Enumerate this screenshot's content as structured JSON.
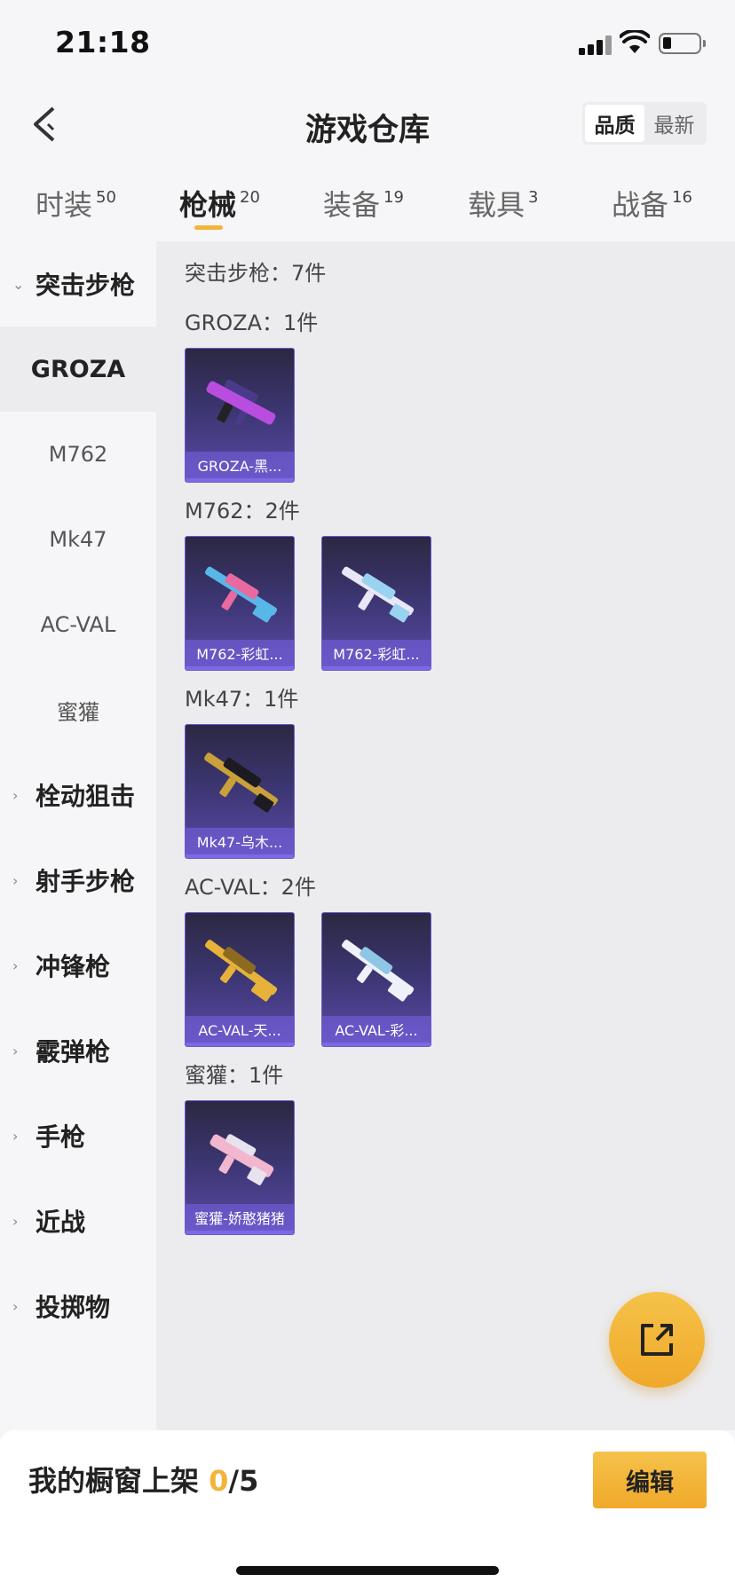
{
  "status_bar": {
    "time": "21:18"
  },
  "nav": {
    "title": "游戏仓库",
    "sort_options": [
      "品质",
      "最新"
    ],
    "sort_selected": "品质"
  },
  "tabs": [
    {
      "label": "时装",
      "count": "50"
    },
    {
      "label": "枪械",
      "count": "20"
    },
    {
      "label": "装备",
      "count": "19"
    },
    {
      "label": "载具",
      "count": "3"
    },
    {
      "label": "战备",
      "count": "16"
    }
  ],
  "sidebar": {
    "expanded_category": "突击步枪",
    "sub_items": [
      "GROZA",
      "M762",
      "Mk47",
      "AC-VAL",
      "蜜獾"
    ],
    "selected_sub": "GROZA",
    "categories": [
      "栓动狙击",
      "射手步枪",
      "冲锋枪",
      "霰弹枪",
      "手枪",
      "近战",
      "投掷物"
    ]
  },
  "content": {
    "header": "突击步枪：7件",
    "groups": [
      {
        "title": "GROZA：1件",
        "items": [
          {
            "label": "GROZA-黑...",
            "colors": [
              "#b84de0",
              "#4a3b8a"
            ]
          }
        ]
      },
      {
        "title": "M762：2件",
        "items": [
          {
            "label": "M762-彩虹...",
            "colors": [
              "#e86aa0",
              "#57b8e8"
            ]
          },
          {
            "label": "M762-彩虹...",
            "colors": [
              "#e9e6f7",
              "#9ad3ef"
            ]
          }
        ]
      },
      {
        "title": "Mk47：1件",
        "items": [
          {
            "label": "Mk47-乌木...",
            "colors": [
              "#c9a03a",
              "#1d1b22"
            ]
          }
        ]
      },
      {
        "title": "AC-VAL：2件",
        "items": [
          {
            "label": "AC-VAL-天...",
            "colors": [
              "#e6b23a",
              "#8c6a1f"
            ]
          },
          {
            "label": "AC-VAL-彩...",
            "colors": [
              "#eef0fa",
              "#8fc6e6"
            ]
          }
        ]
      },
      {
        "title": "蜜獾：1件",
        "items": [
          {
            "label": "蜜獾-娇憨猪猪",
            "colors": [
              "#f2b6cf",
              "#e6e2ee"
            ]
          }
        ]
      }
    ]
  },
  "bottom": {
    "label": "我的橱窗上架 ",
    "count": "0",
    "total": "/5",
    "edit_label": "编辑"
  },
  "theme": {
    "accent": "#f2b43a",
    "card_purple": "#5a4aa8"
  }
}
